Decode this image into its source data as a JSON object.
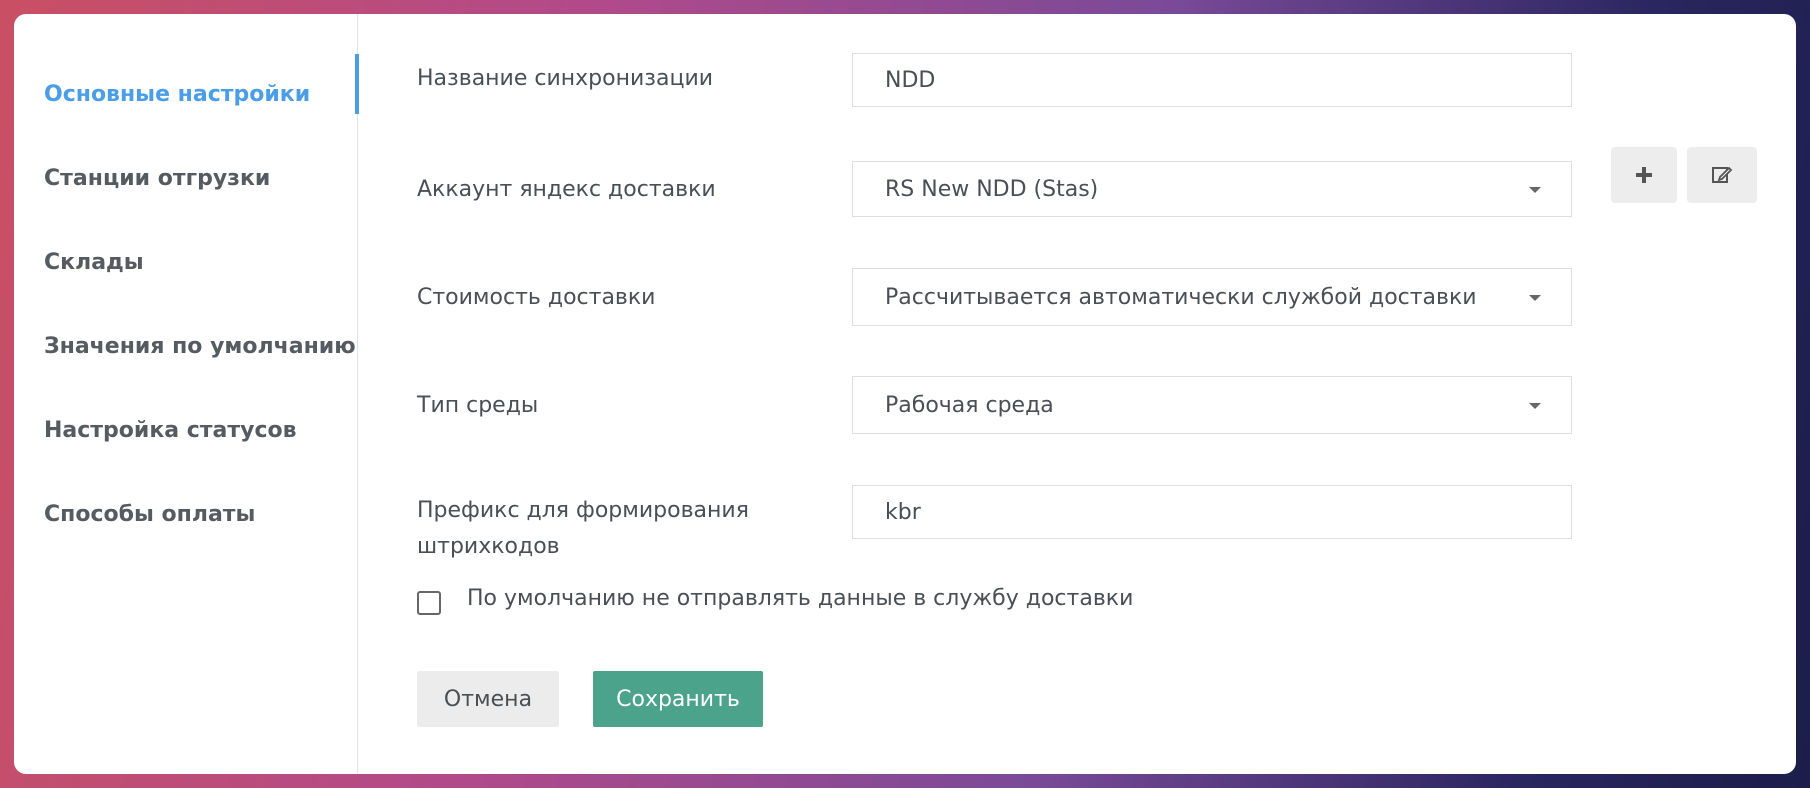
{
  "sidebar": {
    "items": [
      {
        "label": "Основные настройки",
        "active": true
      },
      {
        "label": "Станции отгрузки"
      },
      {
        "label": "Склады"
      },
      {
        "label": "Значения по умолчанию"
      },
      {
        "label": "Настройка статусов"
      },
      {
        "label": "Способы оплаты"
      }
    ]
  },
  "form": {
    "sync_name": {
      "label": "Название синхронизации",
      "value": "NDD"
    },
    "account": {
      "label": "Аккаунт яндекс доставки",
      "value": "RS New NDD (Stas)"
    },
    "delivery_cost": {
      "label": "Стоимость доставки",
      "value": "Рассчитывается автоматически службой доставки"
    },
    "environment": {
      "label": "Тип среды",
      "value": "Рабочая среда"
    },
    "prefix": {
      "label_line1": "Префикс для формирования",
      "label_line2": "штрихкодов",
      "value": "kbr"
    },
    "no_send": {
      "label": "По умолчанию не отправлять данные в службу доставки",
      "checked": false
    }
  },
  "buttons": {
    "cancel": "Отмена",
    "save": "Сохранить"
  },
  "colors": {
    "accent": "#4a9ee8",
    "save": "#4aa38a"
  },
  "icons": {
    "add": "plus-icon",
    "edit": "edit-icon"
  }
}
